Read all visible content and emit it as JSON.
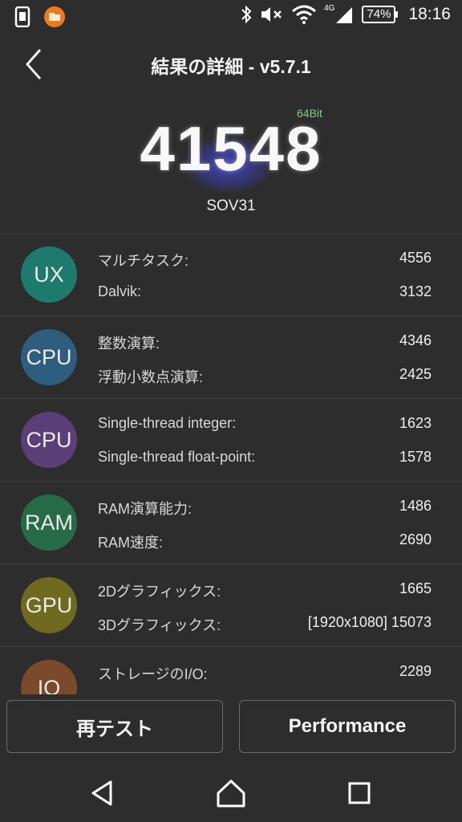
{
  "status_bar": {
    "time": "18:16",
    "battery": "74%",
    "network": "4G",
    "icons": [
      "screenshot-app-icon",
      "folder-app-icon",
      "bluetooth-icon",
      "mute-icon",
      "wifi-icon",
      "signal-icon",
      "battery-icon"
    ]
  },
  "header": {
    "title": "結果の詳細 - v5.7.1"
  },
  "score": {
    "value": "41548",
    "bits": "64Bit",
    "device": "SOV31"
  },
  "categories": [
    {
      "badge": "UX",
      "color": "#1f7a6e",
      "items": [
        {
          "label": "マルチタスク:",
          "value": "4556"
        },
        {
          "label": "Dalvik:",
          "value": "3132"
        }
      ]
    },
    {
      "badge": "CPU",
      "color": "#2f5d7d",
      "items": [
        {
          "label": "整数演算:",
          "value": "4346"
        },
        {
          "label": "浮動小数点演算:",
          "value": "2425"
        }
      ]
    },
    {
      "badge": "CPU",
      "color": "#5b3f78",
      "items": [
        {
          "label": "Single-thread integer:",
          "value": "1623"
        },
        {
          "label": "Single-thread float-point:",
          "value": "1578"
        }
      ]
    },
    {
      "badge": "RAM",
      "color": "#276a47",
      "items": [
        {
          "label": "RAM演算能力:",
          "value": "1486"
        },
        {
          "label": "RAM速度:",
          "value": "2690"
        }
      ]
    },
    {
      "badge": "GPU",
      "color": "#6e6a20",
      "items": [
        {
          "label": "2Dグラフィックス:",
          "value": "1665"
        },
        {
          "label": "3Dグラフィックス:",
          "value": "[1920x1080] 15073"
        }
      ]
    },
    {
      "badge": "IO",
      "color": "#7a4a2a",
      "items": [
        {
          "label": "ストレージのI/O:",
          "value": "2289"
        }
      ]
    }
  ],
  "buttons": {
    "retest": "再テスト",
    "performance": "Performance"
  }
}
